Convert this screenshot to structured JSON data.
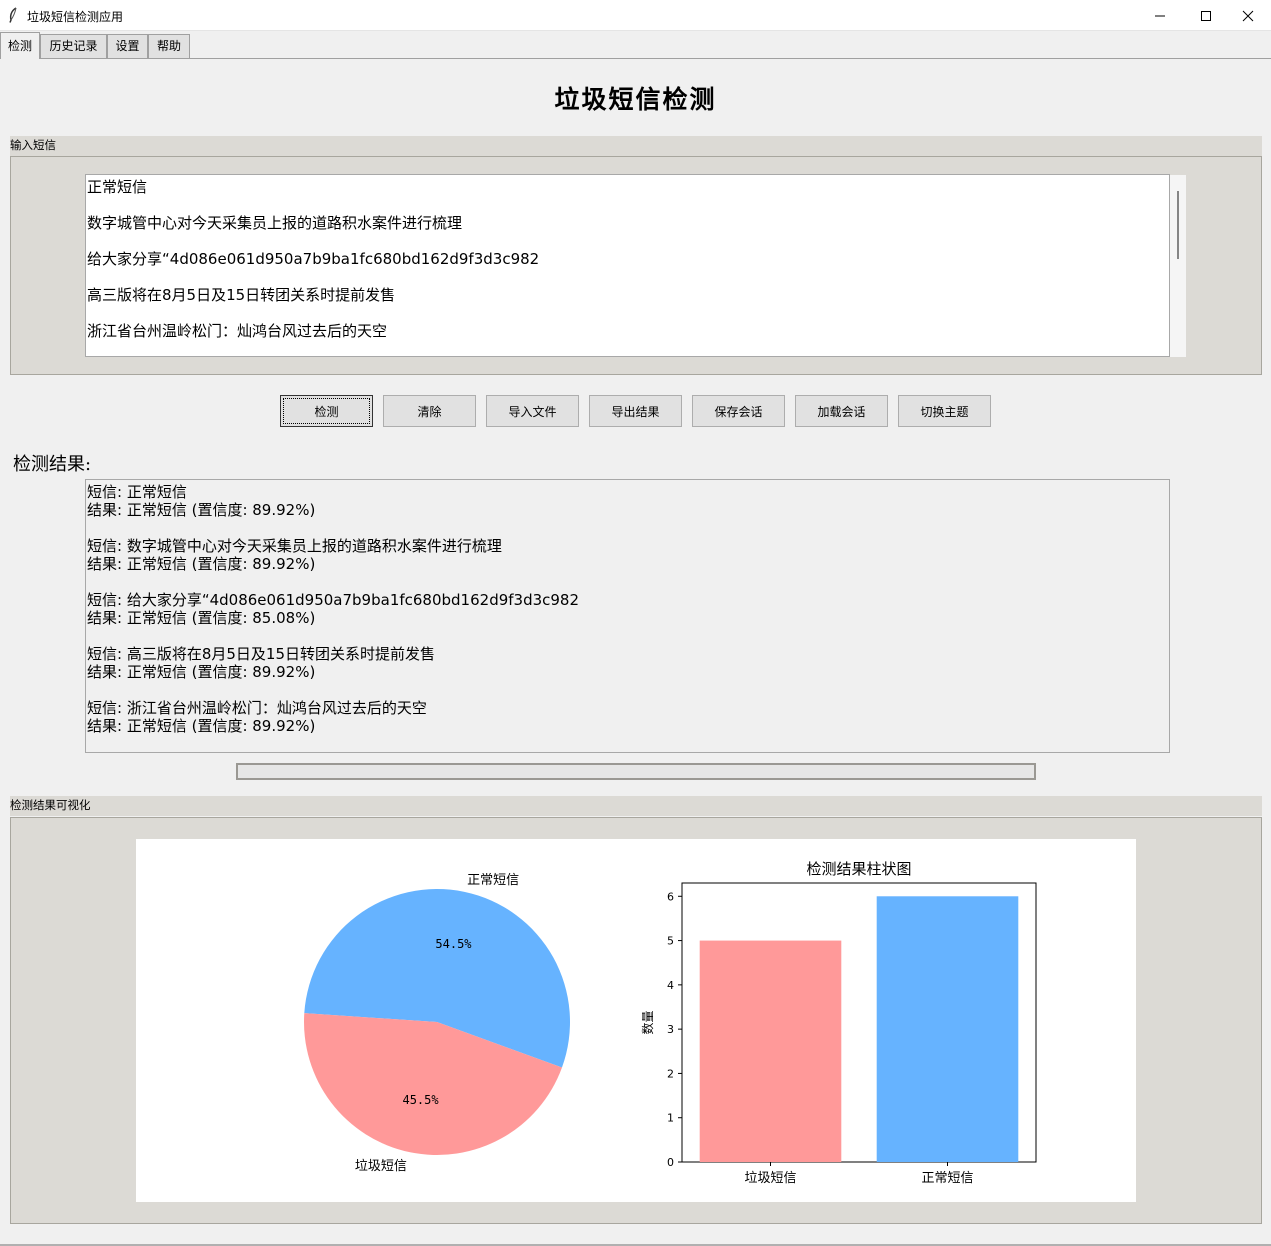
{
  "window": {
    "title": "垃圾短信检测应用",
    "icon": "feather-icon"
  },
  "tabs": [
    {
      "label": "检测",
      "active": true
    },
    {
      "label": "历史记录",
      "active": false
    },
    {
      "label": "设置",
      "active": false
    },
    {
      "label": "帮助",
      "active": false
    }
  ],
  "header": {
    "title": "垃圾短信检测"
  },
  "input_section": {
    "label": "输入短信",
    "lines": [
      "正常短信",
      "数字城管中心对今天采集员上报的道路积水案件进行梳理",
      "给大家分享“4d086e061d950a7b9ba1fc680bd162d9f3d3c982",
      "高三版将在8月5日及15日转团关系时提前发售",
      "浙江省台州温岭松门：灿鸿台风过去后的天空"
    ]
  },
  "buttons": {
    "detect": "检测",
    "clear": "清除",
    "import": "导入文件",
    "export": "导出结果",
    "save": "保存会话",
    "load": "加载会话",
    "theme": "切换主题"
  },
  "results": {
    "label": "检测结果:",
    "entries": [
      {
        "sms": "短信: 正常短信",
        "result": "结果: 正常短信 (置信度: 89.92%)"
      },
      {
        "sms": "短信: 数字城管中心对今天采集员上报的道路积水案件进行梳理",
        "result": "结果: 正常短信 (置信度: 89.92%)"
      },
      {
        "sms": "短信: 给大家分享“4d086e061d950a7b9ba1fc680bd162d9f3d3c982",
        "result": "结果: 正常短信 (置信度: 85.08%)"
      },
      {
        "sms": "短信: 高三版将在8月5日及15日转团关系时提前发售",
        "result": "结果: 正常短信 (置信度: 89.92%)"
      },
      {
        "sms": "短信: 浙江省台州温岭松门：灿鸿台风过去后的天空",
        "result": "结果: 正常短信 (置信度: 89.92%)"
      }
    ]
  },
  "progress": {
    "value": 0
  },
  "visualization": {
    "label": "检测结果可视化"
  },
  "colors": {
    "spam": "#ff9999",
    "normal": "#66b3ff"
  },
  "chart_data": [
    {
      "type": "pie",
      "labels": [
        "正常短信",
        "垃圾短信"
      ],
      "values": [
        54.5,
        45.5
      ],
      "pct_labels": [
        "54.5%",
        "45.5%"
      ]
    },
    {
      "type": "bar",
      "title": "检测结果柱状图",
      "categories": [
        "垃圾短信",
        "正常短信"
      ],
      "values": [
        5,
        6
      ],
      "ylabel": "数量",
      "ylim": [
        0,
        6.3
      ],
      "yticks": [
        "0",
        "1",
        "2",
        "3",
        "4",
        "5",
        "6"
      ]
    }
  ]
}
